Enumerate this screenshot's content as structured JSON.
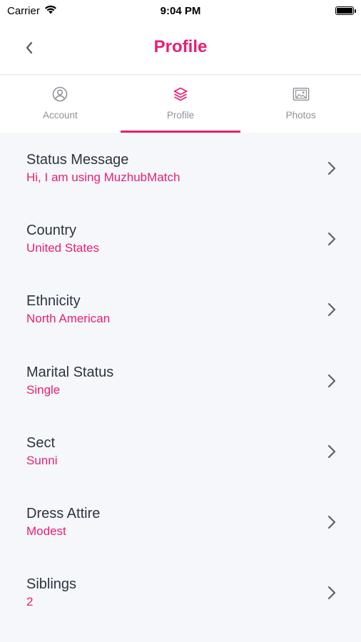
{
  "status_bar": {
    "carrier": "Carrier",
    "time": "9:04 PM"
  },
  "header": {
    "title": "Profile",
    "back_icon": "chevron-left-icon"
  },
  "tabs": [
    {
      "label": "Account",
      "icon": "person-circle-icon",
      "active": false
    },
    {
      "label": "Profile",
      "icon": "layers-icon",
      "active": true
    },
    {
      "label": "Photos",
      "icon": "photo-icon",
      "active": false
    }
  ],
  "profile_fields": [
    {
      "label": "Status Message",
      "value": "Hi, I am using MuzhubMatch"
    },
    {
      "label": "Country",
      "value": "United States"
    },
    {
      "label": "Ethnicity",
      "value": "North American"
    },
    {
      "label": "Marital Status",
      "value": "Single"
    },
    {
      "label": "Sect",
      "value": "Sunni"
    },
    {
      "label": "Dress Attire",
      "value": "Modest"
    },
    {
      "label": "Siblings",
      "value": "2"
    }
  ],
  "colors": {
    "accent": "#ea1e72",
    "background": "#f5f7fa",
    "text": "#2d3440",
    "muted": "#8e9299"
  }
}
